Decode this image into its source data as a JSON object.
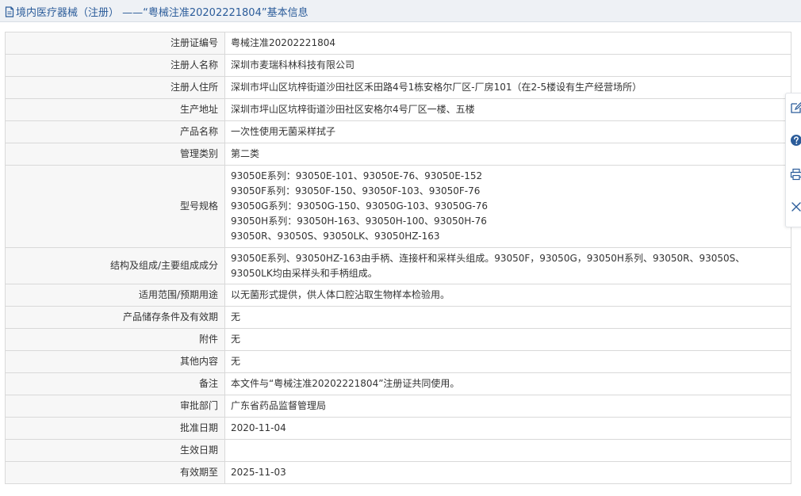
{
  "header": {
    "title": "境内医疗器械（注册） ——“粤械注准20202221804”基本信息"
  },
  "details": [
    {
      "label": "注册证编号",
      "value": "粤械注准20202221804"
    },
    {
      "label": "注册人名称",
      "value": "深圳市麦瑞科林科技有限公司"
    },
    {
      "label": "注册人住所",
      "value": "深圳市坪山区坑梓街道沙田社区禾田路4号1栋安格尔厂区-厂房101（在2-5楼设有生产经营场所）"
    },
    {
      "label": "生产地址",
      "value": "深圳市坪山区坑梓街道沙田社区安格尔4号厂区一楼、五楼"
    },
    {
      "label": "产品名称",
      "value": "一次性使用无菌采样拭子"
    },
    {
      "label": "管理类别",
      "value": "第二类"
    },
    {
      "label": "型号规格",
      "lines": [
        "93050E系列：93050E-101、93050E-76、93050E-152",
        "93050F系列：93050F-150、93050F-103、93050F-76",
        "93050G系列：93050G-150、93050G-103、93050G-76",
        "93050H系列：93050H-163、93050H-100、93050H-76",
        "93050R、93050S、93050LK、93050HZ-163"
      ]
    },
    {
      "label": "结构及组成/主要组成成分",
      "value": "93050E系列、93050HZ-163由手柄、连接杆和采样头组成。93050F，93050G，93050H系列、93050R、93050S、93050LK均由采样头和手柄组成。"
    },
    {
      "label": "适用范围/预期用途",
      "value": "以无菌形式提供，供人体口腔沾取生物样本检验用。"
    },
    {
      "label": "产品储存条件及有效期",
      "value": "无"
    },
    {
      "label": "附件",
      "value": "无"
    },
    {
      "label": "其他内容",
      "value": "无"
    },
    {
      "label": "备注",
      "value": "本文件与“粤械注准20202221804”注册证共同使用。"
    },
    {
      "label": "审批部门",
      "value": "广东省药品监督管理局"
    },
    {
      "label": "批准日期",
      "value": "2020-11-04"
    },
    {
      "label": "生效日期",
      "value": ""
    },
    {
      "label": "有效期至",
      "value": "2025-11-03"
    }
  ],
  "side_toolbar": {
    "icons": [
      "edit-icon",
      "help-icon",
      "print-icon",
      "close-icon"
    ],
    "colors": {
      "icon": "#2b5c9a"
    }
  },
  "colors": {
    "header_bg": "#eef1f5",
    "header_text": "#2b5c9a",
    "label_bg": "#f7f7f7",
    "border": "#d9d9d9"
  }
}
